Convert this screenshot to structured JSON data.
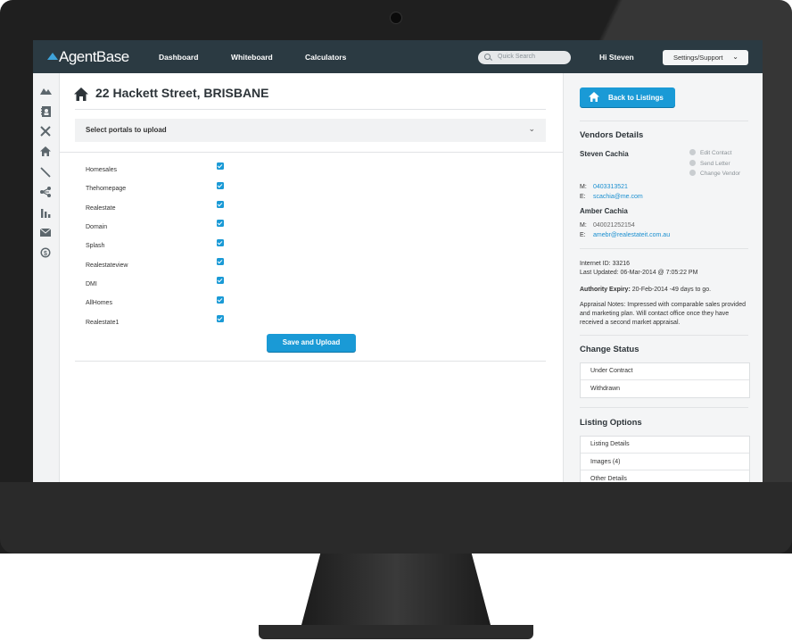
{
  "app": {
    "logo_text": "AgentBase"
  },
  "topnav": {
    "items": [
      "Dashboard",
      "Whiteboard",
      "Calculators"
    ],
    "search_placeholder": "Quick Search",
    "greeting": "Hi Steven",
    "settings_label": "Settings/Support"
  },
  "sidebar_icons": [
    "chart-area-icon",
    "contacts-icon",
    "tools-icon",
    "home-icon",
    "pen-icon",
    "share-icon",
    "bar-chart-icon",
    "mail-icon",
    "dollar-icon"
  ],
  "main": {
    "title": "22 Hackett Street, BRISBANE",
    "portal_section_label": "Select portals to upload",
    "portals": [
      {
        "name": "Homesales",
        "checked": true
      },
      {
        "name": "Thehomepage",
        "checked": true
      },
      {
        "name": "Realestate",
        "checked": true
      },
      {
        "name": "Domain",
        "checked": true
      },
      {
        "name": "Splash",
        "checked": true
      },
      {
        "name": "Realestateview",
        "checked": true
      },
      {
        "name": "DMI",
        "checked": true
      },
      {
        "name": "AllHomes",
        "checked": true
      },
      {
        "name": "Realestate1",
        "checked": true
      }
    ],
    "save_label": "Save and Upload"
  },
  "right": {
    "back_label": "Back to Listings",
    "vendors_heading": "Vendors Details",
    "vendor1": {
      "name": "Steven Cachia",
      "m_label": "M:",
      "mobile": "0403313521",
      "e_label": "E:",
      "email": "scachia@me.com"
    },
    "vendor_actions": [
      "Edit Contact",
      "Send Letter",
      "Change Vendor"
    ],
    "vendor2": {
      "name": "Amber Cachia",
      "m_label": "M:",
      "mobile": "040021252154",
      "e_label": "E:",
      "email": "amebr@realestateit.com.au"
    },
    "internet_id": "Internet ID: 33216",
    "last_updated": "Last Updated: 06-Mar-2014 @ 7:05:22 PM",
    "authority_label": "Authority Expiry:",
    "authority_value": " 20-Feb-2014 -49 days to go.",
    "appraisal_line1": "Appraisal Notes: Impressed with comparable sales provided",
    "appraisal_line2": "and marketing plan. Will contact office once they have",
    "appraisal_line3": "received a second market appraisal.",
    "change_status_heading": "Change Status",
    "status_options": [
      "Under Contract",
      "Withdrawn"
    ],
    "listing_options_heading": "Listing Options",
    "listing_options": [
      "Listing Details",
      "Images (4)",
      "Other Details"
    ]
  },
  "colors": {
    "accent": "#1a9ad6",
    "topbar": "#2b3a42"
  }
}
